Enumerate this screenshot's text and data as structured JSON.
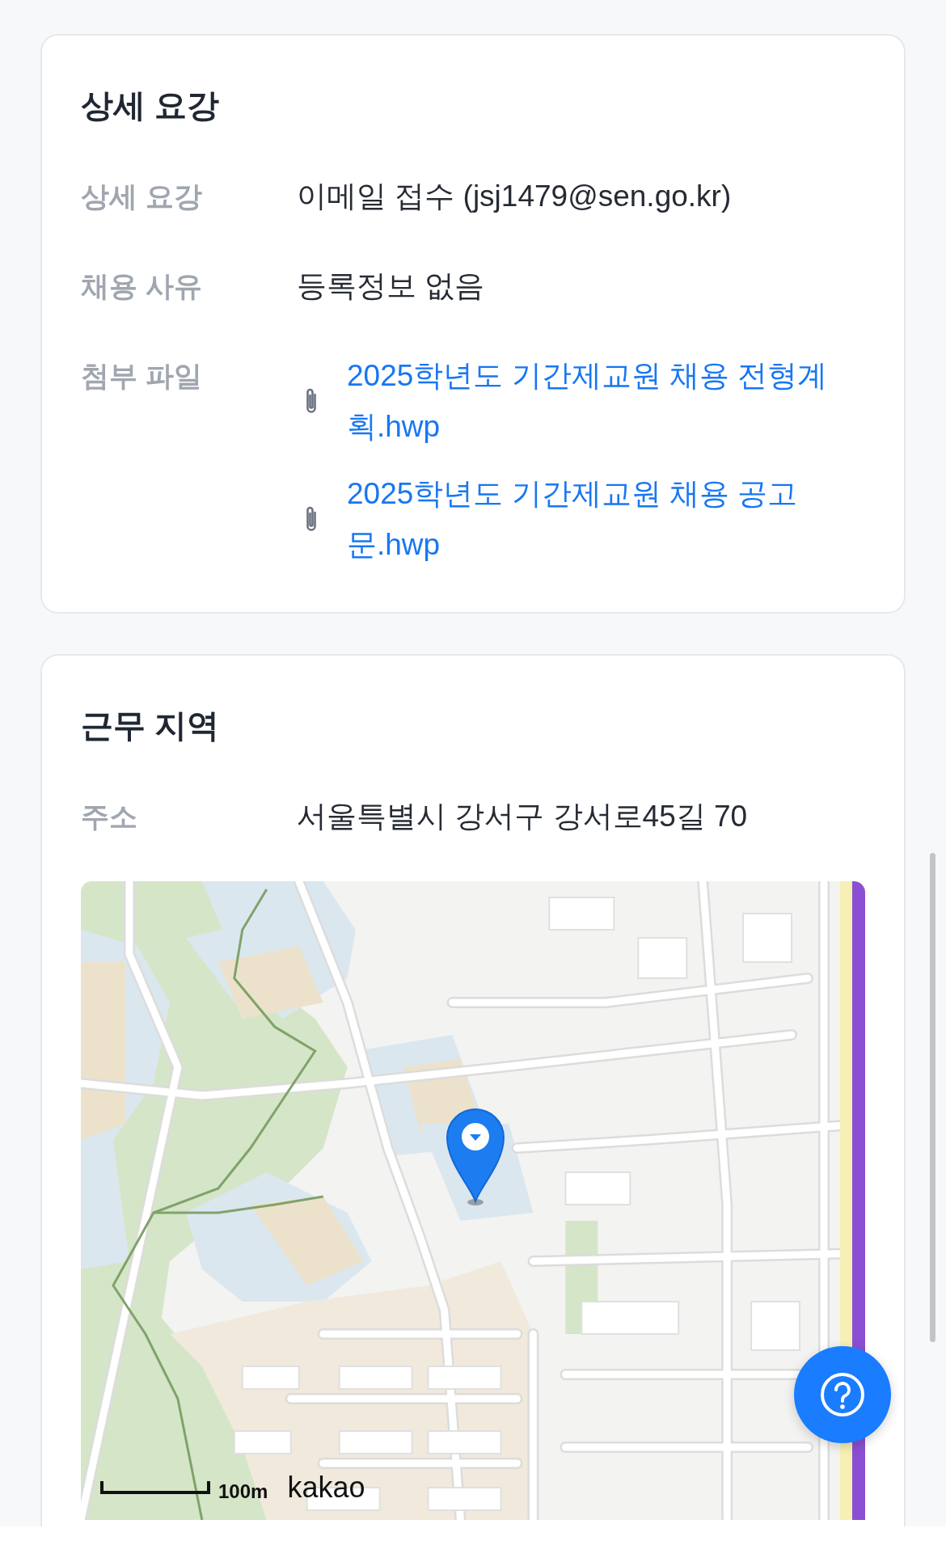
{
  "sections": [
    {
      "title": "상세 요강",
      "rows": [
        {
          "kind": "text",
          "label": "상세 요강",
          "value": "이메일 접수 (jsj1479@sen.go.kr)"
        },
        {
          "kind": "text",
          "label": "채용 사유",
          "value": "등록정보 없음"
        },
        {
          "kind": "files",
          "label": "첨부 파일",
          "files": [
            "2025학년도 기간제교원 채용 전형계획.hwp",
            "2025학년도 기간제교원 채용 공고문.hwp"
          ]
        }
      ]
    },
    {
      "title": "근무 지역",
      "rows": [
        {
          "kind": "text",
          "label": "주소",
          "value": "서울특별시 강서구 강서로45길 70"
        }
      ],
      "map": {
        "scale": "100m",
        "logo": "kakao"
      }
    }
  ]
}
